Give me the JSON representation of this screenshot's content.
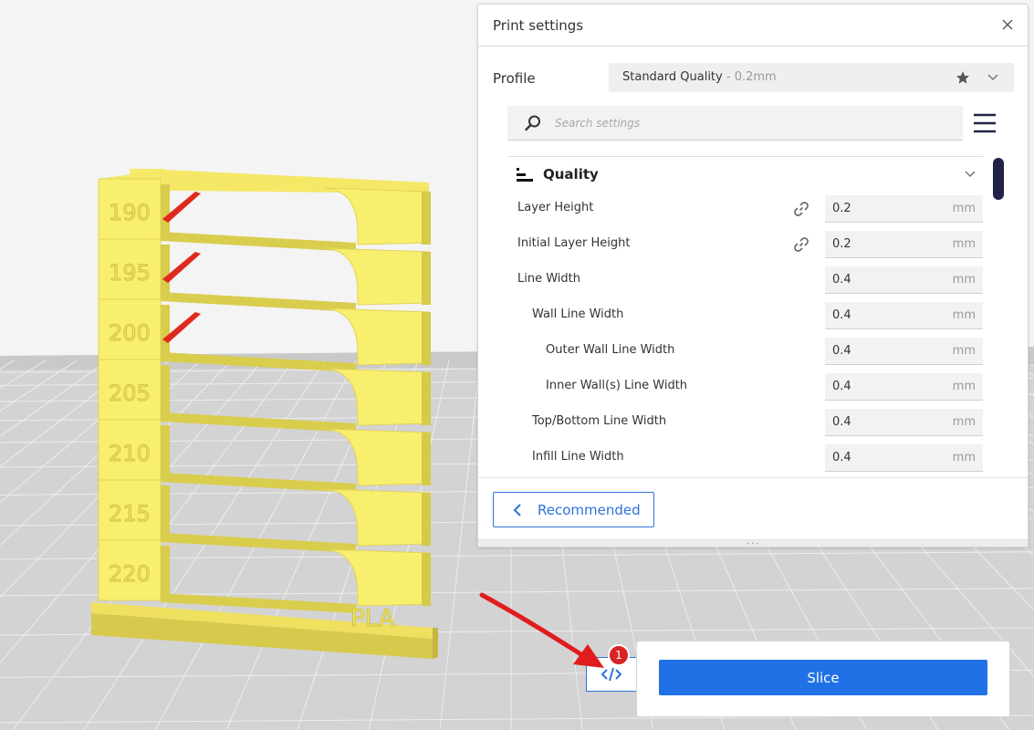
{
  "print_settings": {
    "title": "Print settings",
    "profile_label": "Profile",
    "profile_name": "Standard Quality",
    "profile_suffix": " - 0.2mm",
    "search_placeholder": "Search settings",
    "category": {
      "title": "Quality",
      "settings": [
        {
          "label": "Layer Height",
          "value": "0.2",
          "unit": "mm",
          "indent": 0,
          "linked": true
        },
        {
          "label": "Initial Layer Height",
          "value": "0.2",
          "unit": "mm",
          "indent": 0,
          "linked": true
        },
        {
          "label": "Line Width",
          "value": "0.4",
          "unit": "mm",
          "indent": 0,
          "linked": false
        },
        {
          "label": "Wall Line Width",
          "value": "0.4",
          "unit": "mm",
          "indent": 1,
          "linked": false
        },
        {
          "label": "Outer Wall Line Width",
          "value": "0.4",
          "unit": "mm",
          "indent": 2,
          "linked": false
        },
        {
          "label": "Inner Wall(s) Line Width",
          "value": "0.4",
          "unit": "mm",
          "indent": 2,
          "linked": false
        },
        {
          "label": "Top/Bottom Line Width",
          "value": "0.4",
          "unit": "mm",
          "indent": 1,
          "linked": false
        },
        {
          "label": "Infill Line Width",
          "value": "0.4",
          "unit": "mm",
          "indent": 1,
          "linked": false
        }
      ]
    },
    "recommended_label": "Recommended"
  },
  "slice": {
    "button_label": "Slice",
    "badge_count": "1"
  },
  "model": {
    "temperature_labels": [
      "190",
      "195",
      "200",
      "205",
      "210",
      "215",
      "220"
    ],
    "material_label": "PLA",
    "color": "#f9ef6e"
  },
  "colors": {
    "accent": "#2071e6",
    "scrollbar": "#1e2347",
    "badge": "#d92323",
    "arrow": "#e01d1d"
  }
}
